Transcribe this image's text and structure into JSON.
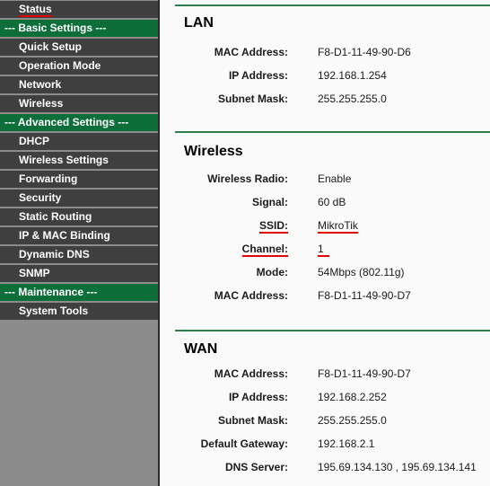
{
  "sidebar": {
    "items": [
      {
        "type": "item",
        "label": "Status",
        "highlight": true
      },
      {
        "type": "group",
        "label": "--- Basic Settings ---"
      },
      {
        "type": "item",
        "label": "Quick Setup"
      },
      {
        "type": "item",
        "label": "Operation Mode"
      },
      {
        "type": "item",
        "label": "Network"
      },
      {
        "type": "item",
        "label": "Wireless"
      },
      {
        "type": "group",
        "label": "--- Advanced Settings ---"
      },
      {
        "type": "item",
        "label": "DHCP"
      },
      {
        "type": "item",
        "label": "Wireless Settings"
      },
      {
        "type": "item",
        "label": "Forwarding"
      },
      {
        "type": "item",
        "label": "Security"
      },
      {
        "type": "item",
        "label": "Static Routing"
      },
      {
        "type": "item",
        "label": "IP & MAC Binding"
      },
      {
        "type": "item",
        "label": "Dynamic DNS"
      },
      {
        "type": "item",
        "label": "SNMP"
      },
      {
        "type": "group",
        "label": "--- Maintenance ---"
      },
      {
        "type": "item",
        "label": "System Tools"
      }
    ]
  },
  "lan": {
    "title": "LAN",
    "rows": [
      {
        "label": "MAC Address:",
        "value": "F8-D1-11-49-90-D6"
      },
      {
        "label": "IP Address:",
        "value": "192.168.1.254"
      },
      {
        "label": "Subnet Mask:",
        "value": "255.255.255.0"
      }
    ]
  },
  "wireless": {
    "title": "Wireless",
    "rows": [
      {
        "label": "Wireless Radio:",
        "value": "Enable"
      },
      {
        "label": "Signal:",
        "value": "60 dB"
      },
      {
        "label": "SSID:",
        "value": "MikroTik",
        "underline": true
      },
      {
        "label": "Channel:",
        "value": "1",
        "underline": true
      },
      {
        "label": "Mode:",
        "value": "54Mbps (802.11g)"
      },
      {
        "label": "MAC Address:",
        "value": "F8-D1-11-49-90-D7"
      }
    ]
  },
  "wan": {
    "title": "WAN",
    "rows": [
      {
        "label": "MAC Address:",
        "value": "F8-D1-11-49-90-D7"
      },
      {
        "label": "IP Address:",
        "value": "192.168.2.252"
      },
      {
        "label": "Subnet Mask:",
        "value": "255.255.255.0"
      },
      {
        "label": "Default Gateway:",
        "value": "192.168.2.1"
      },
      {
        "label": "DNS Server:",
        "value": "195.69.134.130 , 195.69.134.141"
      }
    ]
  },
  "colors": {
    "nav_bg": "#3f3f3f",
    "group_bg": "#0d6e3a",
    "separator": "#2e7d4a",
    "annotation": "#e00000"
  }
}
